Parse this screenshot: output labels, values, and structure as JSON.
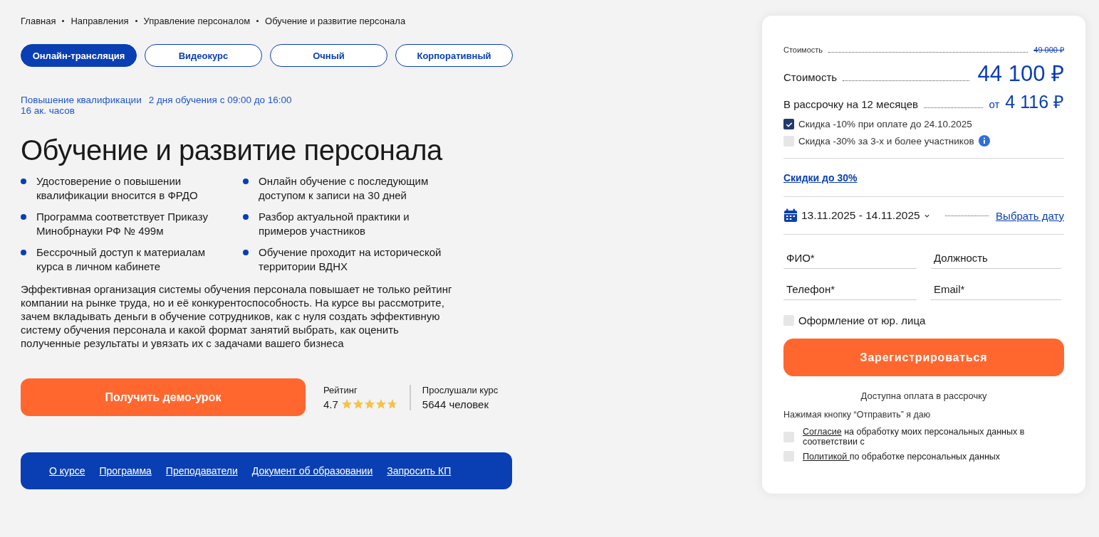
{
  "breadcrumbs": [
    "Главная",
    "Направления",
    "Управление персоналом",
    "Обучение и развитие персонала"
  ],
  "format_tabs": [
    {
      "label": "Онлайн-трансляция",
      "selected": true
    },
    {
      "label": "Видеокурс",
      "selected": false
    },
    {
      "label": "Очный",
      "selected": false
    },
    {
      "label": "Корпоративный",
      "selected": false
    }
  ],
  "meta": [
    "Повышение квалификации",
    "2 дня обучения с 09:00 до 16:00",
    "16 ак. часов"
  ],
  "title": "Обучение и развитие персонала",
  "features": [
    [
      "Удостоверение о повышении квалификации вносится в ФРДО",
      "Программа соответствует Приказу Минобрнауки РФ № 499м",
      "Бессрочный доступ к материалам курса в личном кабинете"
    ],
    [
      "Онлайн обучение с последующим доступом к записи на 30 дней",
      "Разбор актуальной практики и примеров участников",
      "Обучение проходит на исторической территории ВДНХ"
    ]
  ],
  "description": "Эффективная организация системы обучения персонала повышает не только рейтинг компании на рынке труда, но и её конкурентоспособность. На курсе вы рассмотрите, зачем вкладывать деньги в обучение сотрудников, как с нуля создать эффективную систему обучения персонала и какой формат занятий выбрать, как оценить полученные результаты и увязать их с задачами вашего бизнеса",
  "demo_button": "Получить демо-урок",
  "rating": {
    "label": "Рейтинг",
    "value": "4.7",
    "stars": 4.7
  },
  "listeners": {
    "label": "Прослушали курс",
    "value": "5644 человек"
  },
  "nav_links": [
    "О курсе",
    "Программа",
    "Преподаватели",
    "Документ об образовании",
    "Запросить КП"
  ],
  "order": {
    "old_price_label": "Стоимость",
    "old_price": "49 000 ₽",
    "price_label": "Стоимость",
    "price": "44 100 ₽",
    "installment_label": "В рассрочку на 12 месяцев",
    "installment_prefix": "от",
    "installment": "4 116 ₽",
    "discounts": [
      {
        "label": "Скидка -10% при оплате до 24.10.2025",
        "checked": true,
        "info": false
      },
      {
        "label": "Скидка -30% за 3-х и более участников",
        "checked": false,
        "info": true
      }
    ],
    "discount_link": "Скидки до 30%",
    "dates": "13.11.2025 - 14.11.2025",
    "choose_date": "Выбрать дату",
    "fields": [
      {
        "placeholder": "ФИО*"
      },
      {
        "placeholder": "Должность"
      },
      {
        "placeholder": "Телефон*"
      },
      {
        "placeholder": "Email*"
      }
    ],
    "legal_entity": {
      "label": "Оформление от юр. лица",
      "checked": false
    },
    "submit": "Зарегистрироваться",
    "installment_note": "Доступна оплата в рассрочку",
    "consent_intro": "Нажимая кнопку “Отправить” я даю",
    "consents": [
      {
        "link": "Согласие",
        "text": "на обработку моих персональных данных в соответствии с",
        "checked": false
      },
      {
        "link": "Политикой ",
        "text": "по обработке персональных данных",
        "checked": false
      }
    ]
  }
}
